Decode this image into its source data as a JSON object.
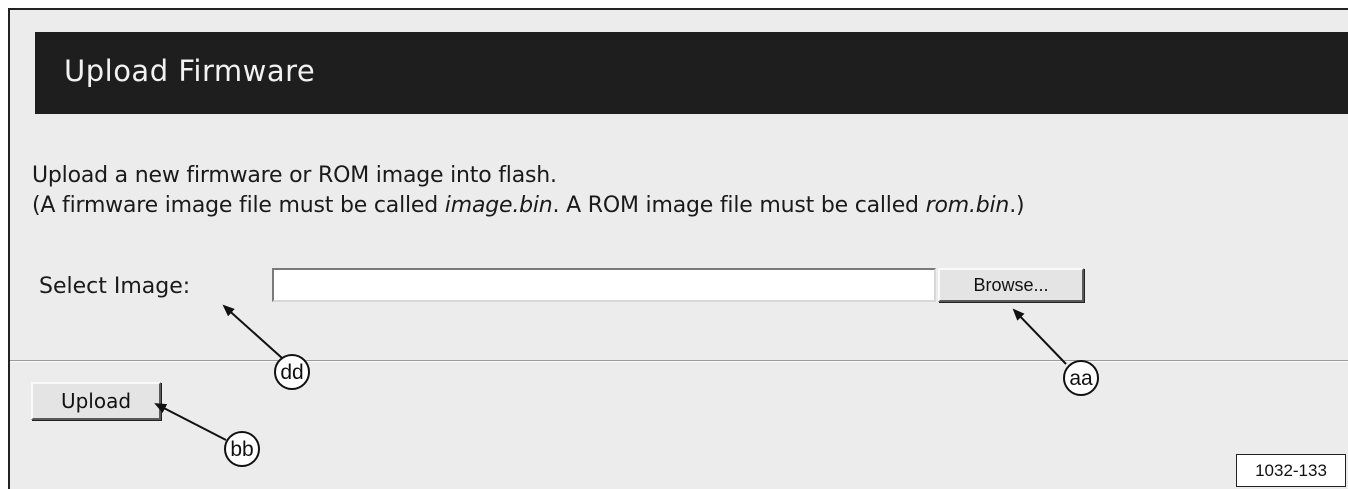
{
  "header": {
    "title": "Upload Firmware"
  },
  "description": {
    "line1": "Upload a new firmware or ROM image into flash.",
    "line2_prefix": "(A firmware image file must be called ",
    "firmware_filename": "image.bin",
    "line2_middle": ". A ROM image file must be called ",
    "rom_filename": "rom.bin",
    "line2_suffix": ".)"
  },
  "form": {
    "select_label": "Select Image:",
    "file_value": "",
    "browse_label": "Browse...",
    "upload_label": "Upload"
  },
  "callouts": {
    "aa": "aa",
    "bb": "bb",
    "dd": "dd"
  },
  "figure_code": "1032-133",
  "colors": {
    "header_bg": "#1e1e1e",
    "page_bg": "#ececec"
  }
}
